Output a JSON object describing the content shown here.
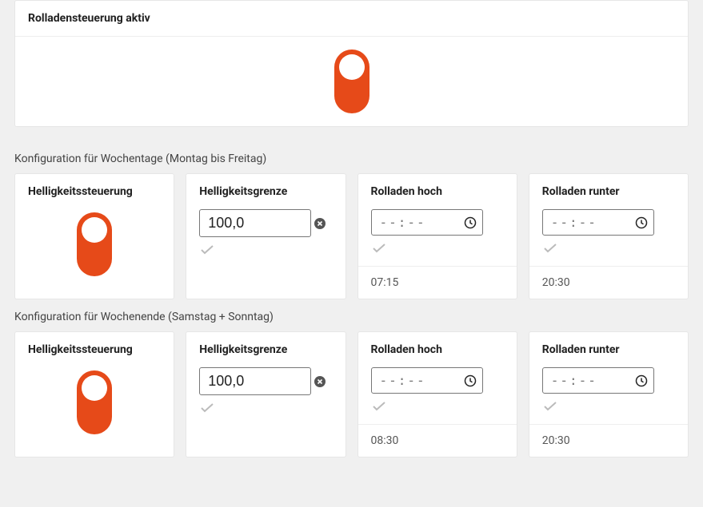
{
  "main": {
    "title": "Rolladensteuerung aktiv"
  },
  "sections": {
    "weekday": {
      "label": "Konfiguration für Wochentage (Montag bis Freitag)",
      "brightness_control": {
        "title": "Helligkeitssteuerung"
      },
      "brightness_limit": {
        "title": "Helligkeitsgrenze",
        "value": "100,0"
      },
      "up": {
        "title": "Rolladen hoch",
        "placeholder": "--:--",
        "current": "07:15"
      },
      "down": {
        "title": "Rolladen runter",
        "placeholder": "--:--",
        "current": "20:30"
      }
    },
    "weekend": {
      "label": "Konfiguration für Wochenende (Samstag + Sonntag)",
      "brightness_control": {
        "title": "Helligkeitssteuerung"
      },
      "brightness_limit": {
        "title": "Helligkeitsgrenze",
        "value": "100,0"
      },
      "up": {
        "title": "Rolladen hoch",
        "placeholder": "--:--",
        "current": "08:30"
      },
      "down": {
        "title": "Rolladen runter",
        "placeholder": "--:--",
        "current": "20:30"
      }
    }
  }
}
